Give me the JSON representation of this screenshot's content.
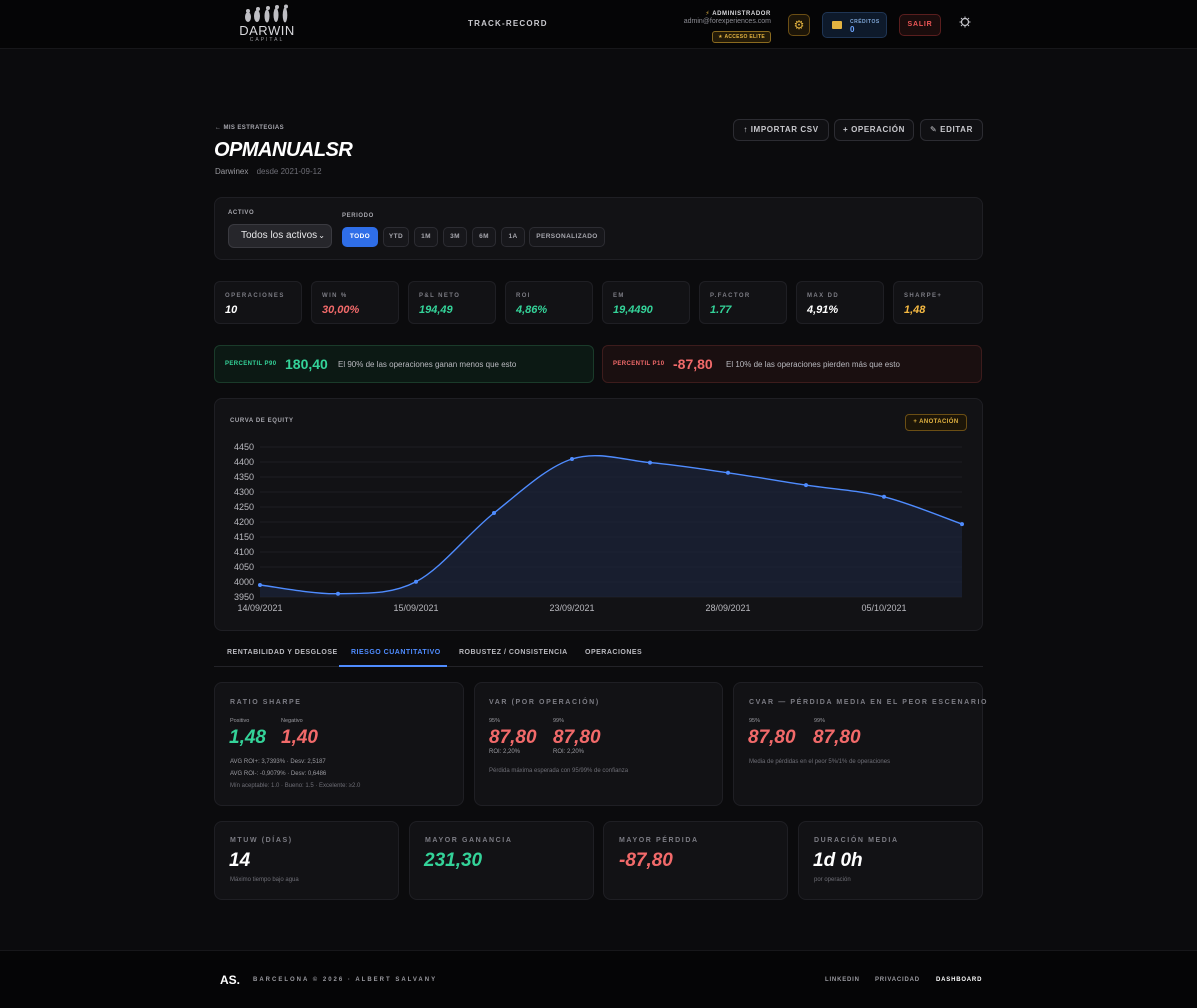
{
  "header": {
    "brand": "DARWIN",
    "brand_sub": "CAPITAL",
    "nav_track": "TRACK-RECORD",
    "user_role": "ADMINISTRADOR",
    "user_email": "admin@forexperiences.com",
    "elite_badge": "★ ACCESO ELITE",
    "credits_label": "CRÉDITOS",
    "credits_value": "0",
    "logout_label": "SALIR",
    "icons": [
      "gear-icon",
      "wallet-icon",
      "theme-toggle-icon"
    ]
  },
  "page": {
    "back_link": "← MIS ESTRATEGIAS",
    "title": "OPMANUALSR",
    "broker": "Darwinex",
    "since": "desde 2021-09-12",
    "actions": {
      "import_csv": "↑ IMPORTAR CSV",
      "add_operation": "+ OPERACIÓN",
      "edit": "✎ EDITAR"
    }
  },
  "filters": {
    "asset_label": "ACTIVO",
    "asset_value": "Todos los activos",
    "period_label": "PERIODO",
    "periods": [
      "TODO",
      "YTD",
      "1M",
      "3M",
      "6M",
      "1A",
      "PERSONALIZADO"
    ],
    "active_period": "TODO"
  },
  "kpis": [
    {
      "label": "OPERACIONES",
      "value": "10",
      "color": "#ffffff"
    },
    {
      "label": "WIN %",
      "value": "30,00%",
      "color": "#f26a6a"
    },
    {
      "label": "P&L NETO",
      "value": "194,49",
      "color": "#34d399"
    },
    {
      "label": "ROI",
      "value": "4,86%",
      "color": "#34d399"
    },
    {
      "label": "EM",
      "value": "19,4490",
      "color": "#34d399"
    },
    {
      "label": "P.FACTOR",
      "value": "1.77",
      "color": "#34d399"
    },
    {
      "label": "MAX DD",
      "value": "4,91%",
      "color": "#ffffff"
    },
    {
      "label": "SHARPE+",
      "value": "1,48",
      "color": "#f5b942"
    }
  ],
  "percentiles": {
    "p90": {
      "label": "PERCENTIL P90",
      "value": "180,40",
      "desc": "El 90% de las operaciones ganan menos que esto"
    },
    "p10": {
      "label": "PERCENTIL P10",
      "value": "-87,80",
      "desc": "El 10% de las operaciones pierden más que esto"
    }
  },
  "chart_section": {
    "title": "CURVA DE EQUITY",
    "annotation_button": "+ ANOTACIÓN"
  },
  "chart_data": {
    "type": "area",
    "title": "CURVA DE EQUITY",
    "x_ticks": [
      "14/09/2021",
      "15/09/2021",
      "23/09/2021",
      "28/09/2021",
      "05/10/2021"
    ],
    "y_ticks": [
      3950,
      4000,
      4050,
      4100,
      4150,
      4200,
      4250,
      4300,
      4350,
      4400,
      4450
    ],
    "ylim": [
      3950,
      4450
    ],
    "points": [
      3990,
      3961,
      4001,
      4230,
      4410,
      4398,
      4364,
      4323,
      4284,
      4193
    ],
    "line_color": "#4f8cff",
    "grid": true
  },
  "tabs": [
    "RENTABILIDAD Y DESGLOSE",
    "RIESGO CUANTITATIVO",
    "ROBUSTEZ / CONSISTENCIA",
    "OPERACIONES"
  ],
  "active_tab": "RIESGO CUANTITATIVO",
  "sharpe": {
    "title": "RATIO SHARPE",
    "pos_label": "Positivo",
    "neg_label": "Negativo",
    "pos_value": "1,48",
    "neg_value": "1,40",
    "avg_pos": "AVG ROI+: 3,7393% · Desv: 2,5187",
    "avg_neg": "AVG ROI-: -0,9079% · Desv: 0,6486",
    "hint": "Mín aceptable: 1.0 · Bueno: 1.5 · Excelente: ≥2.0"
  },
  "var": {
    "title": "VAR (POR OPERACIÓN)",
    "l95": "95%",
    "l99": "99%",
    "v95": "87,80",
    "v99": "87,80",
    "roi95": "ROI: 2,20%",
    "roi99": "ROI: 2,20%",
    "note": "Pérdida máxima esperada con 95/99% de confianza"
  },
  "cvar": {
    "title": "CVAR — PÉRDIDA MEDIA EN EL PEOR ESCENARIO",
    "l95": "95%",
    "l99": "99%",
    "v95": "87,80",
    "v99": "87,80",
    "note": "Media de pérdidas en el peor 5%/1% de operaciones"
  },
  "mtuw": {
    "title": "MTUW (DÍAS)",
    "value": "14",
    "note": "Máximo tiempo bajo agua"
  },
  "max_gain": {
    "title": "MAYOR GANANCIA",
    "value": "231,30"
  },
  "max_loss": {
    "title": "MAYOR PÉRDIDA",
    "value": "-87,80"
  },
  "avg_duration": {
    "title": "DURACIÓN MEDIA",
    "value": "1d 0h",
    "note": "por operación"
  },
  "footer": {
    "logo": "AS.",
    "copyright": "BARCELONA © 2026 · ALBERT SALVANY",
    "links": [
      "LINKEDIN",
      "PRIVACIDAD",
      "DASHBOARD"
    ]
  }
}
